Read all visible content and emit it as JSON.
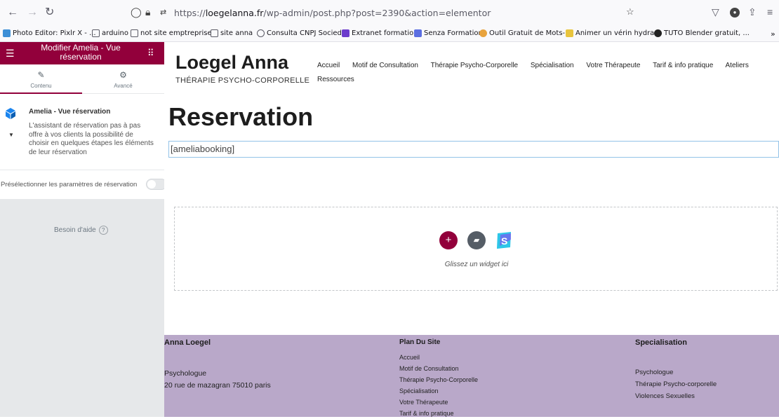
{
  "browser": {
    "url_prefix": "https://",
    "url_domain": "loegelanna.fr",
    "url_path": "/wp-admin/post.php?post=2390&action=elementor",
    "bookmarks": [
      {
        "label": "Photo Editor: Pixlr X - ...",
        "color": "#3d8fd6"
      },
      {
        "label": "arduino",
        "color": "#ffffff"
      },
      {
        "label": "not site emptreprise",
        "color": "#ffffff"
      },
      {
        "label": "site anna",
        "color": "#ffffff"
      },
      {
        "label": "Consulta CNPJ Socied...",
        "color": "#ffffff"
      },
      {
        "label": "Extranet formation",
        "color": "#6c3ccc"
      },
      {
        "label": "Senza Formation",
        "color": "#5b6ee1"
      },
      {
        "label": "Outil Gratuit de Mots-...",
        "color": "#e8a33d"
      },
      {
        "label": "Animer un vérin hydra...",
        "color": "#e8c43d"
      },
      {
        "label": "TUTO Blender gratuit, ...",
        "color": "#222222"
      }
    ]
  },
  "panel": {
    "title": "Modifier Amelia - Vue réservation",
    "tab_content": "Contenu",
    "tab_advanced": "Avancé",
    "widget_title": "Amelia - Vue réservation",
    "widget_desc": "L'assistant de réservation pas à pas offre à vos clients la possibilité de choisir en quelques étapes les éléments de leur réservation",
    "preselect_label": "Présélectionner les paramètres de réservation",
    "help_label": "Besoin d'aide",
    "brand_color": "#92003b"
  },
  "site": {
    "logo": "Loegel Anna",
    "tagline": "THÉRAPIE PSYCHO-CORPORELLE",
    "menu": [
      "Accueil",
      "Motif de Consultation",
      "Thérapie Psycho-Corporelle",
      "Spécialisation",
      "Votre Thérapeute",
      "Tarif & info pratique",
      "Ateliers",
      "Ressources"
    ],
    "page_title": "Reservation",
    "shortcode": "[ameliabooking]",
    "dropzone_text": "Glissez un widget ici"
  },
  "footer": {
    "col1_title": "Anna Loegel",
    "col1_lines": [
      "Psychologue",
      "20 rue de mazagran 75010 paris"
    ],
    "col2_title": "Plan Du Site",
    "col2_links": [
      "Accueil",
      "Motif de Consultation",
      "Thérapie Psycho-Corporelle",
      "Spécialisation",
      "Votre Thérapeute",
      "Tarif & info pratique"
    ],
    "col3_title": "Specialisation",
    "col3_lines": [
      "Psychologue",
      "Thérapie Psycho-corporelle",
      "Violences Sexuelles"
    ],
    "bg_color": "#b9a8c9"
  }
}
